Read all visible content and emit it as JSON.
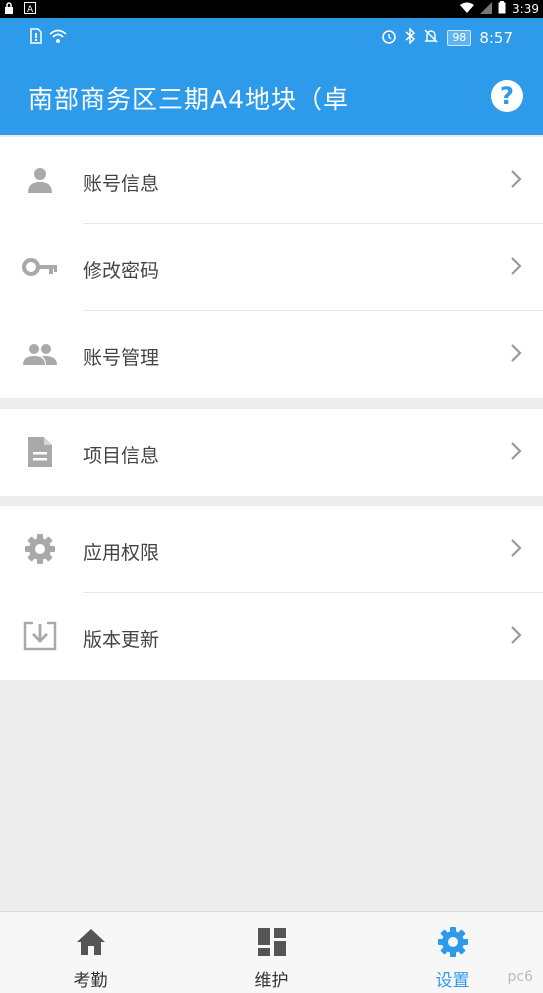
{
  "system_bar": {
    "time": "3:39"
  },
  "app_status": {
    "time": "8:57",
    "battery": "98"
  },
  "header": {
    "title": "南部商务区三期A4地块（卓",
    "help_label": "?"
  },
  "groups": [
    {
      "items": [
        {
          "label": "账号信息",
          "icon": "person-icon"
        },
        {
          "label": "修改密码",
          "icon": "key-icon"
        },
        {
          "label": "账号管理",
          "icon": "people-icon"
        }
      ]
    },
    {
      "items": [
        {
          "label": "项目信息",
          "icon": "document-icon"
        }
      ]
    },
    {
      "items": [
        {
          "label": "应用权限",
          "icon": "gear-icon"
        },
        {
          "label": "版本更新",
          "icon": "download-icon"
        }
      ]
    }
  ],
  "tabs": [
    {
      "label": "考勤",
      "icon": "home-icon"
    },
    {
      "label": "维护",
      "icon": "dashboard-icon"
    },
    {
      "label": "设置",
      "icon": "settings-icon",
      "active": true
    }
  ],
  "watermark": "pc6",
  "colors": {
    "primary": "#2e9bea",
    "icon_gray": "#a9a9a9",
    "background": "#ececec"
  }
}
